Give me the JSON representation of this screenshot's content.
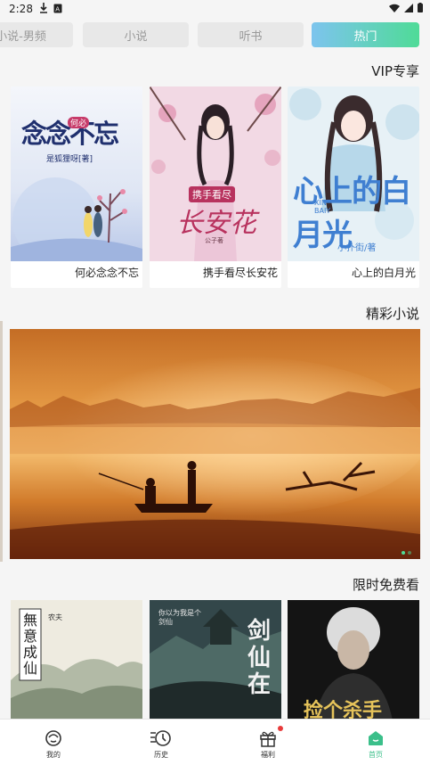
{
  "status_bar": {
    "time": "2:28"
  },
  "tabs": [
    {
      "label": "小说-男频",
      "active": false
    },
    {
      "label": "小说",
      "active": false
    },
    {
      "label": "听书",
      "active": false
    },
    {
      "label": "热门",
      "active": true
    }
  ],
  "vip": {
    "title": "VIP专享",
    "books": [
      {
        "title": "何必念念不忘",
        "cover_text": "念念不忘",
        "cover_small": "何必",
        "cover_author": "是狐狸呀[著]"
      },
      {
        "title": "携手看尽长安花",
        "cover_text": "长安花",
        "cover_small": "携手看尽",
        "cover_author": "公子著"
      },
      {
        "title": "心上的白月光",
        "cover_text": "心上的白月光",
        "cover_small": "XIN BAIY",
        "cover_author": "小扑街/著"
      }
    ]
  },
  "featured": {
    "title": "精彩小说",
    "slides": 2,
    "current_slide": 2
  },
  "free": {
    "title": "限时免费看",
    "books": [
      {
        "cover_text": "無意成仙",
        "cover_small": "农夫"
      },
      {
        "cover_text": "剑仙在",
        "cover_small": "你以为我是个剑仙"
      },
      {
        "cover_text": "捡个杀手"
      }
    ]
  },
  "bottom_nav": [
    {
      "label": "我的",
      "icon": "user-face-icon",
      "active": false
    },
    {
      "label": "历史",
      "icon": "history-clock-icon",
      "active": false
    },
    {
      "label": "福利",
      "icon": "gift-icon",
      "active": false,
      "badge": true
    },
    {
      "label": "首页",
      "icon": "home-icon",
      "active": true
    }
  ],
  "colors": {
    "accent": "#3bbf8a",
    "tab_gradient_start": "#7dc4ee",
    "tab_gradient_end": "#4fdb97",
    "badge": "#e83b3b"
  }
}
